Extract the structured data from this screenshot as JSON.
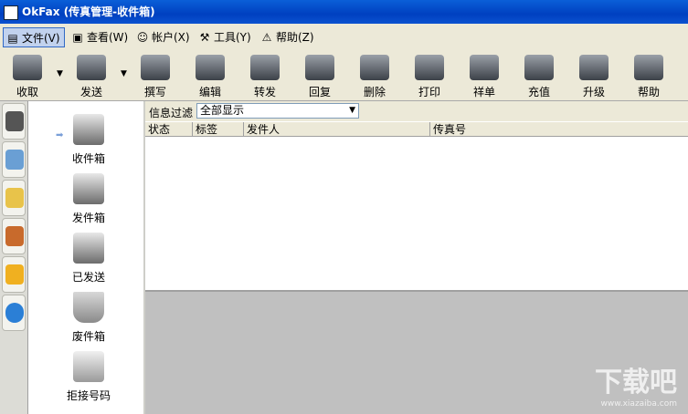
{
  "window": {
    "title": "OkFax (传真管理-收件箱)"
  },
  "menu": [
    {
      "label": "文件(V)",
      "icon": "file-icon",
      "active": true
    },
    {
      "label": "查看(W)",
      "icon": "view-icon"
    },
    {
      "label": "帐户(X)",
      "icon": "users-icon"
    },
    {
      "label": "工具(Y)",
      "icon": "tools-icon"
    },
    {
      "label": "帮助(Z)",
      "icon": "help-icon"
    }
  ],
  "toolbar": [
    {
      "label": "收取",
      "icon": "receive-icon"
    },
    {
      "label": "发送",
      "icon": "send-icon"
    },
    {
      "label": "撰写",
      "icon": "compose-icon"
    },
    {
      "label": "编辑",
      "icon": "edit-icon"
    },
    {
      "label": "转发",
      "icon": "forward-icon"
    },
    {
      "label": "回复",
      "icon": "reply-icon"
    },
    {
      "label": "删除",
      "icon": "delete-icon"
    },
    {
      "label": "打印",
      "icon": "print-icon"
    },
    {
      "label": "祥单",
      "icon": "detail-icon"
    },
    {
      "label": "充值",
      "icon": "recharge-icon"
    },
    {
      "label": "升级",
      "icon": "upgrade-icon"
    },
    {
      "label": "帮助",
      "icon": "help-book-icon"
    }
  ],
  "side_tabs": [
    "fax-icon",
    "computer-icon",
    "mail-icon",
    "people-icon",
    "bell-icon",
    "ie-icon"
  ],
  "folders": [
    {
      "label": "收件箱",
      "icon": "inbox-fax-icon",
      "selected": true
    },
    {
      "label": "发件箱",
      "icon": "outbox-fax-icon"
    },
    {
      "label": "已发送",
      "icon": "sent-fax-icon"
    },
    {
      "label": "废件箱",
      "icon": "trash-basket-icon"
    },
    {
      "label": "拒接号码",
      "icon": "blocked-numbers-icon"
    }
  ],
  "filter": {
    "label": "信息过滤",
    "value": "全部显示"
  },
  "columns": [
    "状态",
    "标签",
    "发件人",
    "传真号"
  ],
  "watermark": {
    "text": "下载吧",
    "sub": "www.xiazaiba.com"
  }
}
